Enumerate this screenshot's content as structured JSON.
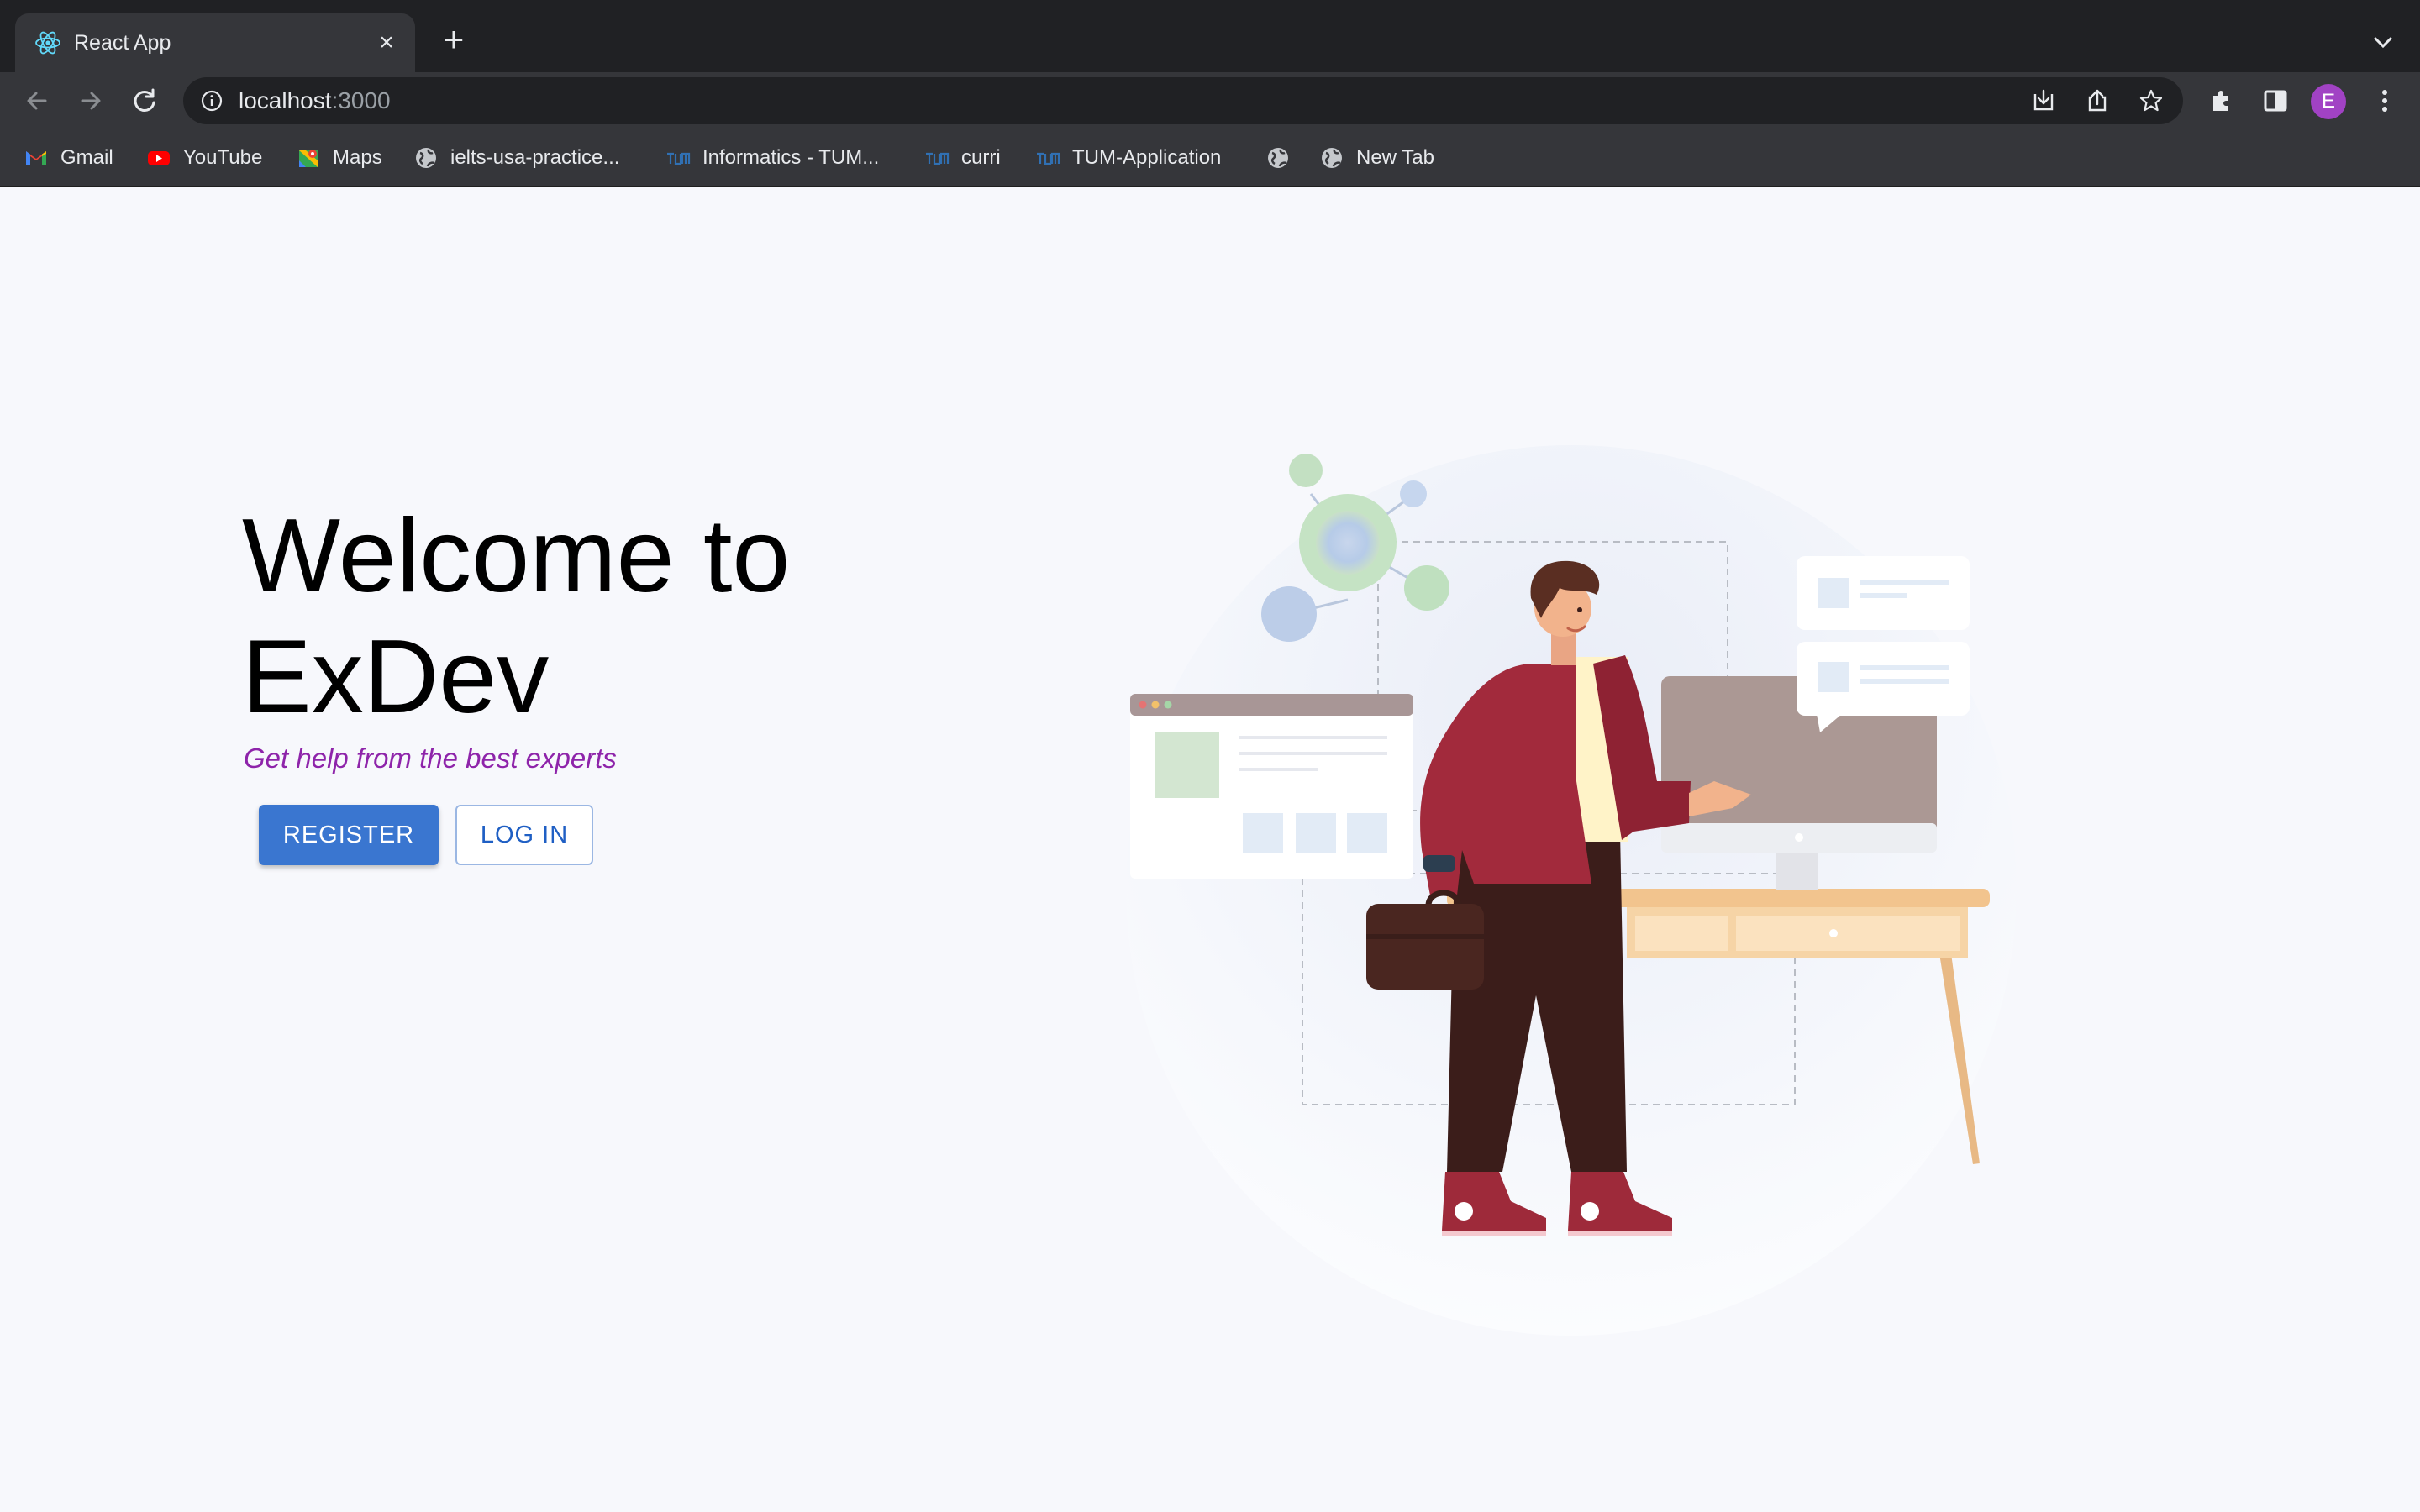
{
  "browser": {
    "tab": {
      "title": "React App",
      "favicon": "react-logo-icon"
    },
    "address": {
      "host": "localhost",
      "port": ":3000"
    },
    "profile_initial": "E",
    "bookmarks": [
      {
        "label": "Gmail",
        "icon": "gmail-icon"
      },
      {
        "label": "YouTube",
        "icon": "youtube-icon"
      },
      {
        "label": "Maps",
        "icon": "maps-icon"
      },
      {
        "label": "ielts-usa-practice...",
        "icon": "globe-icon"
      },
      {
        "label": "Informatics - TUM...",
        "icon": "tum-icon"
      },
      {
        "label": "curri",
        "icon": "tum-icon"
      },
      {
        "label": "TUM-Application",
        "icon": "tum-icon"
      },
      {
        "label": "",
        "icon": "globe-icon"
      },
      {
        "label": "New Tab",
        "icon": "globe-icon"
      }
    ]
  },
  "page": {
    "title": "Welcome to ExDev",
    "subtitle": "Get help from the best experts",
    "register_label": "REGISTER",
    "login_label": "LOG IN"
  },
  "colors": {
    "primary": "#3a76d0",
    "subtitle": "#8e24aa",
    "page_background": "#f7f8fc"
  }
}
